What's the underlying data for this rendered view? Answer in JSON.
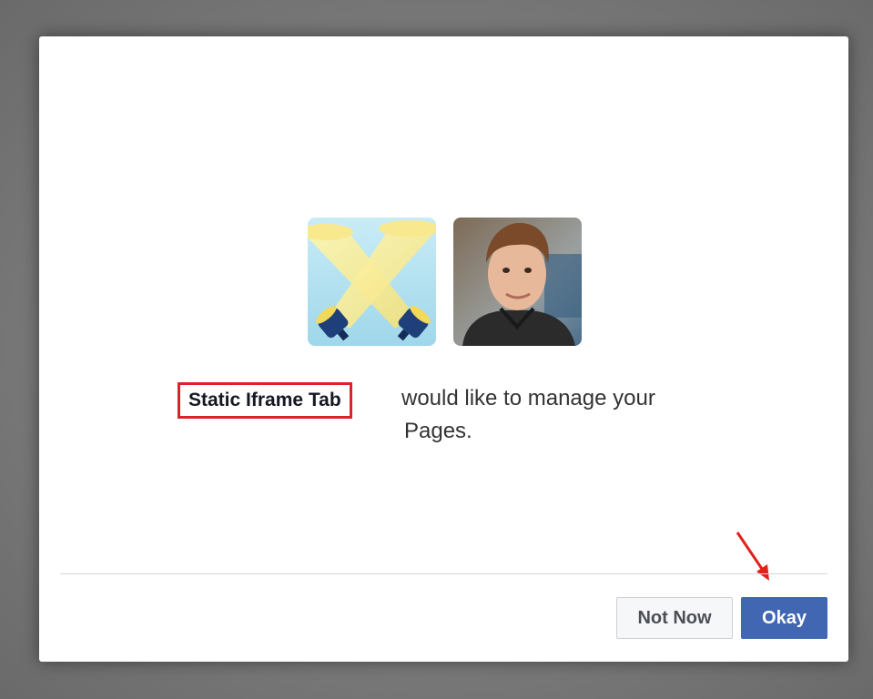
{
  "dialog": {
    "app_name": "Static Iframe Tab",
    "message_line1": "would like to manage your",
    "message_line2": "Pages.",
    "buttons": {
      "not_now": "Not Now",
      "okay": "Okay"
    }
  },
  "icons": {
    "app_icon": "spotlights-icon",
    "user_avatar": "profile-photo",
    "annotation_arrow": "arrow-icon"
  },
  "colors": {
    "okay_button": "#4267b2",
    "highlight_box": "#d8232a",
    "arrow": "#e0221b"
  }
}
